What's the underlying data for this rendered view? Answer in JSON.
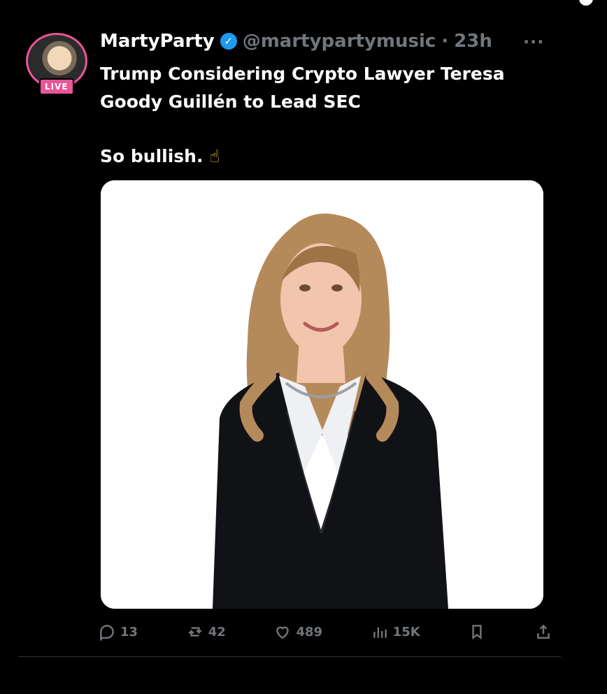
{
  "tweet": {
    "display_name": "MartyParty",
    "handle": "@martypartymusic",
    "separator": "·",
    "time": "23h",
    "more_label": "···",
    "live_badge": "LIVE",
    "text_lines": [
      "Trump Considering Crypto Lawyer Teresa",
      "Goody Guillén to Lead SEC"
    ],
    "comment_line": "So bullish.",
    "emoji": "☝",
    "actions": {
      "replies": "13",
      "retweets": "42",
      "likes": "489",
      "views": "15K"
    }
  },
  "colors": {
    "background": "#000000",
    "text": "#e7e9ea",
    "muted": "#71767b",
    "verified": "#1d9bf0",
    "live": "#e9559a"
  },
  "icons": [
    "reply-icon",
    "retweet-icon",
    "like-icon",
    "views-icon",
    "bookmark-icon",
    "share-icon",
    "verified-icon",
    "more-icon"
  ]
}
